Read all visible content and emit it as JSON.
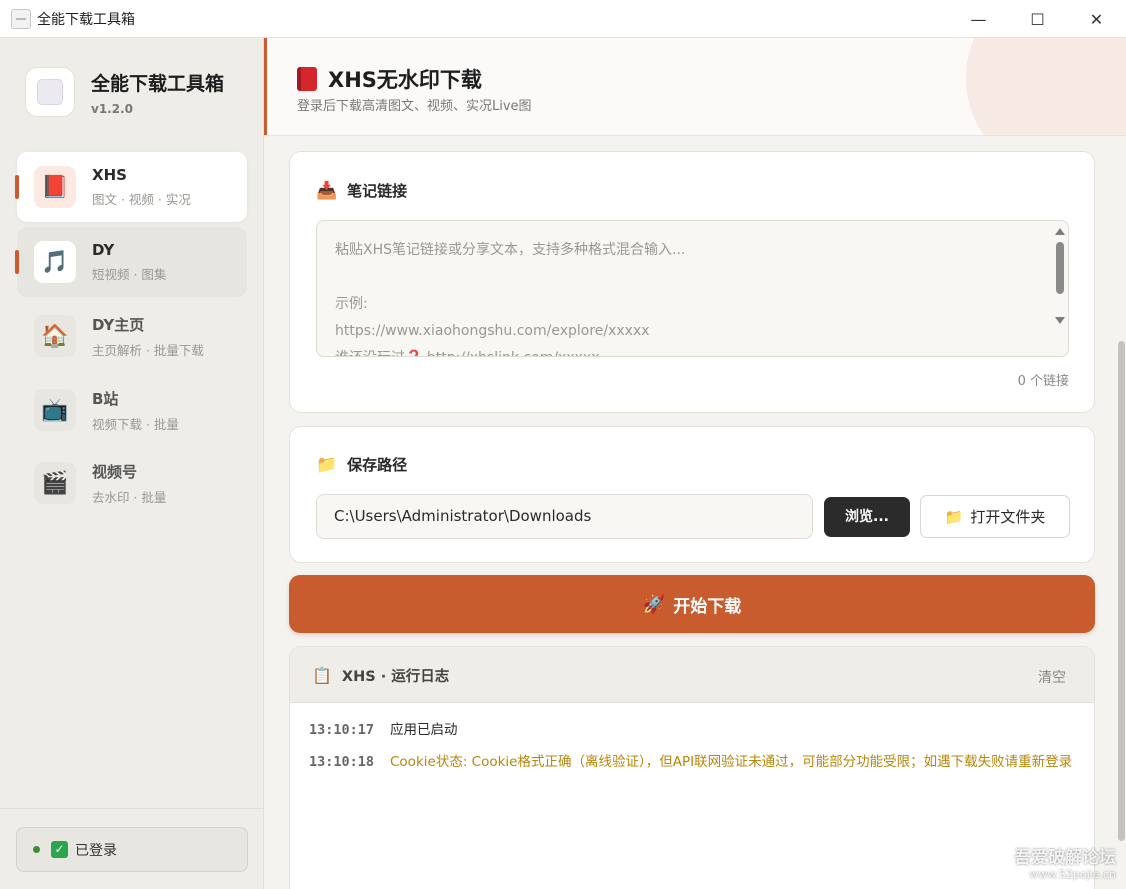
{
  "window": {
    "title": "全能下载工具箱",
    "controls": {
      "minimize": "—",
      "maximize": "☐",
      "close": "✕"
    }
  },
  "sidebar": {
    "brand_name": "全能下载工具箱",
    "version": "v1.2.0",
    "items": [
      {
        "label": "XHS",
        "sub": "图文 · 视频 · 实况",
        "icon": "📕",
        "icon_name": "red-book-icon",
        "state": "active"
      },
      {
        "label": "DY",
        "sub": "短视频 · 图集",
        "icon": "🎵",
        "icon_name": "music-note-icon",
        "state": "hover"
      },
      {
        "label": "DY主页",
        "sub": "主页解析 · 批量下载",
        "icon": "🏠",
        "icon_name": "house-icon",
        "state": "normal"
      },
      {
        "label": "B站",
        "sub": "视频下载 · 批量",
        "icon": "📺",
        "icon_name": "television-icon",
        "state": "normal"
      },
      {
        "label": "视频号",
        "sub": "去水印 · 批量",
        "icon": "🎬",
        "icon_name": "clapperboard-icon",
        "state": "normal"
      }
    ],
    "login_status": "已登录",
    "login_check": "✓"
  },
  "header": {
    "title": "XHS无水印下载",
    "subtitle": "登录后下载高清图文、视频、实况Live图",
    "accent_color": "#c95c2f"
  },
  "link_card": {
    "title": "笔记链接",
    "icon": "📥",
    "lines": [
      "粘贴XHS笔记链接或分享文本，支持多种格式混合输入...",
      "",
      "示例:",
      "https://www.xiaohongshu.com/explore/xxxxx",
      "谁还没玩过❓ http://xhslink.com/xxxxx"
    ],
    "link_count": "0 个链接"
  },
  "path_card": {
    "title": "保存路径",
    "icon": "📁",
    "path_value": "C:\\Users\\Administrator\\Downloads",
    "browse_label": "浏览...",
    "open_folder_label": "打开文件夹",
    "open_folder_icon": "📁"
  },
  "start_button": {
    "label": "开始下载",
    "icon": "🚀",
    "color": "#c95c2f"
  },
  "log": {
    "title": "XHS · 运行日志",
    "icon": "📋",
    "clear_label": "清空",
    "entries": [
      {
        "time": "13:10:17",
        "msg": "应用已启动",
        "level": "info"
      },
      {
        "time": "13:10:18",
        "msg": "Cookie状态: Cookie格式正确（离线验证），但API联网验证未通过，可能部分功能受限；如遇下载失败请重新登录",
        "level": "warn"
      }
    ]
  },
  "watermark": {
    "line1": "吾爱破解论坛",
    "line2": "www.52pojie.cn"
  }
}
